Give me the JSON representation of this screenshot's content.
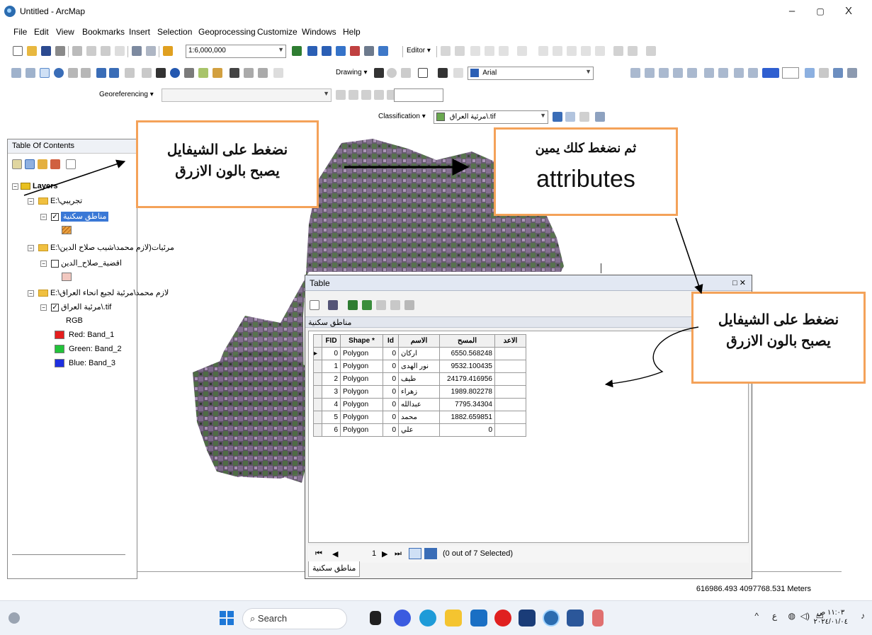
{
  "window": {
    "title": "Untitled - ArcMap",
    "min": "–",
    "max": "▢",
    "close": "X"
  },
  "menu": [
    "File",
    "Edit",
    "View",
    "Bookmarks",
    "Insert",
    "Selection",
    "Geoprocessing",
    "Customize",
    "Windows",
    "Help"
  ],
  "toolbar": {
    "scale": "1:6,000,000",
    "editor": "Editor ▾",
    "drawing": "Drawing ▾",
    "font": "Arial",
    "georeferencing": "Georeferencing ▾",
    "classification": "Classification ▾",
    "raster_layer": "مرئية العراق\\.tif"
  },
  "toc": {
    "title": "Table Of Contents",
    "layers_label": "Layers",
    "group1": "E:\\تجريبي",
    "layer1": "مناطق سكنية",
    "group2": "E:\\مرئيات(لازم محمد\\شيب صلاح الدين",
    "layer2": "اقضية_صلاح_الدين",
    "group3": "E:\\لازم محمد\\مرئية لجيع انحاء العراق",
    "layer3": "مرئية العراق\\.tif",
    "rgb": "RGB",
    "bands": [
      {
        "label": "Red:   Band_1",
        "color": "#e51e1e"
      },
      {
        "label": "Green: Band_2",
        "color": "#22c33a"
      },
      {
        "label": "Blue:   Band_3",
        "color": "#1e2fe0"
      }
    ],
    "polygon_color": "#e8a040",
    "polygon2_color": "#f2c8c0"
  },
  "table": {
    "title": "Table",
    "tab_label": "مناطق سكنية",
    "columns": [
      "FID",
      "Shape *",
      "Id",
      "الاسم",
      "المسح",
      "الاعد"
    ],
    "rows": [
      {
        "fid": "0",
        "shape": "Polygon",
        "id": "0",
        "name": "اركان",
        "area": "6550.568248",
        "extra": ""
      },
      {
        "fid": "1",
        "shape": "Polygon",
        "id": "0",
        "name": "نور الهدى",
        "area": "9532.100435",
        "extra": ""
      },
      {
        "fid": "2",
        "shape": "Polygon",
        "id": "0",
        "name": "طيف",
        "area": "24179.416956",
        "extra": ""
      },
      {
        "fid": "3",
        "shape": "Polygon",
        "id": "0",
        "name": "زهراء",
        "area": "1989.802278",
        "extra": ""
      },
      {
        "fid": "4",
        "shape": "Polygon",
        "id": "0",
        "name": "عبدالله",
        "area": "7795.34304",
        "extra": ""
      },
      {
        "fid": "5",
        "shape": "Polygon",
        "id": "0",
        "name": "محمد",
        "area": "1882.659851",
        "extra": ""
      },
      {
        "fid": "6",
        "shape": "Polygon",
        "id": "0",
        "name": "علي",
        "area": "0",
        "extra": ""
      }
    ],
    "nav_first": "⏮",
    "nav_prev": "◀",
    "nav_page": "1",
    "nav_next": "▶",
    "nav_last": "⏭",
    "selected": "(0 out of 7 Selected)",
    "bottom_tab": "مناطق سكنية"
  },
  "notes": {
    "n1_line1": "نضغط على الشيفايل",
    "n1_line2": "يصبح بالون الازرق",
    "n2_line1": "ثم نضغط كلك يمين",
    "n2_line2": "attributes",
    "n3_line1": "نضغط على الشيفايل",
    "n3_line2": "يصبح بالون الازرق"
  },
  "status": {
    "coords": "616986.493  4097768.531 Meters"
  },
  "taskbar": {
    "search": "Search",
    "clock_time": "١١:٠٣ ص",
    "clock_date": "٢٠٢٤/٠١/٠٤",
    "lang": "ع",
    "chevron": "^"
  }
}
